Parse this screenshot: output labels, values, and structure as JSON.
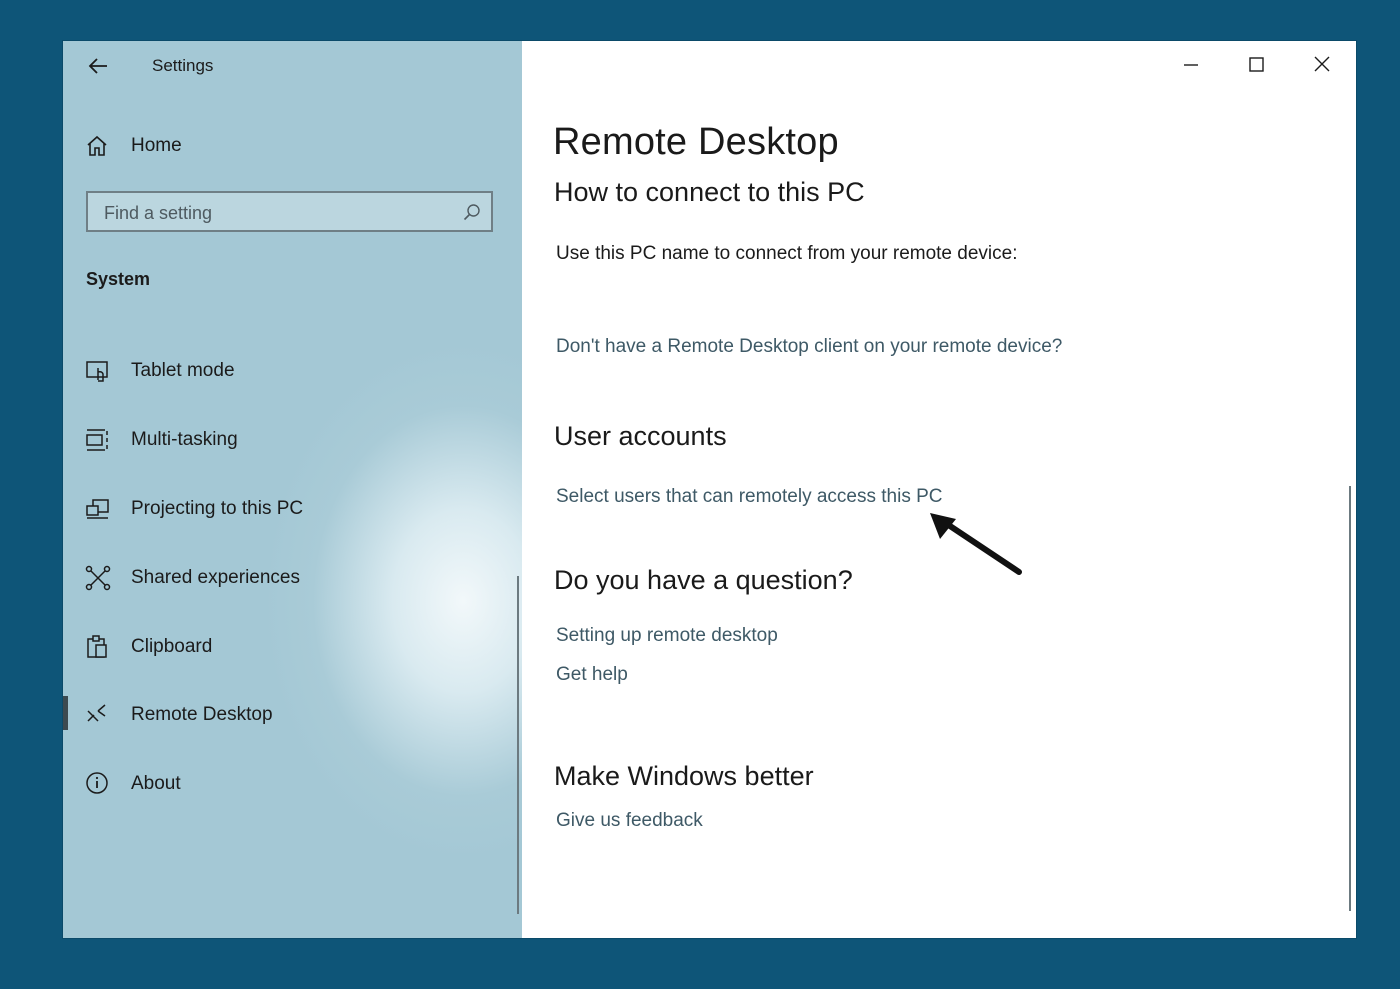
{
  "window": {
    "title": "Settings",
    "controls": {
      "minimize": "minimize-icon",
      "maximize": "maximize-icon",
      "close": "close-icon"
    }
  },
  "sidebar": {
    "home_label": "Home",
    "search": {
      "placeholder": "Find a setting",
      "value": ""
    },
    "section_title": "System",
    "items": [
      {
        "label": "Tablet mode",
        "icon": "tablet-mode-icon"
      },
      {
        "label": "Multi-tasking",
        "icon": "multitasking-icon"
      },
      {
        "label": "Projecting to this PC",
        "icon": "projecting-icon"
      },
      {
        "label": "Shared experiences",
        "icon": "shared-experiences-icon"
      },
      {
        "label": "Clipboard",
        "icon": "clipboard-icon"
      },
      {
        "label": "Remote Desktop",
        "icon": "remote-desktop-icon",
        "selected": true
      },
      {
        "label": "About",
        "icon": "info-icon"
      }
    ]
  },
  "main": {
    "page_title": "Remote Desktop",
    "connect_heading": "How to connect to this PC",
    "connect_text": "Use this PC name to connect from your remote device:",
    "client_link": "Don't have a Remote Desktop client on your remote device?",
    "user_accounts_heading": "User accounts",
    "select_users_link": "Select users that can remotely access this PC",
    "question_heading": "Do you have a question?",
    "help_links": [
      "Setting up remote desktop",
      "Get help"
    ],
    "feedback_heading": "Make Windows better",
    "feedback_link": "Give us feedback"
  },
  "colors": {
    "desktop_bg": "#0e5578",
    "sidebar_bg": "#a4c8d5",
    "link": "#3e5966",
    "text": "#1b1b1b"
  }
}
